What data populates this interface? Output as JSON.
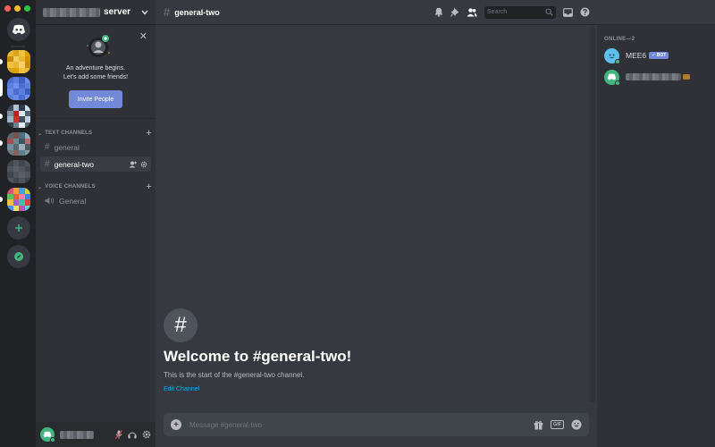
{
  "window": {
    "traffic_colors": [
      "#ff5f57",
      "#febc2e",
      "#28c840"
    ]
  },
  "servers": {
    "icons": [
      {
        "name": "server-1",
        "colors": [
          "#e8b830",
          "#d9a520",
          "#f0c040",
          "#e0a000",
          "#c98a10",
          "#f2d060",
          "#e8b830",
          "#d59000",
          "#f0c040",
          "#e8b830",
          "#fad070",
          "#c98a10",
          "#d9a520",
          "#e0a000",
          "#f0c040",
          "#e8b830"
        ]
      },
      {
        "name": "server-2",
        "colors": [
          "#4a6fd0",
          "#5b7fe0",
          "#3d5fc0",
          "#6a8ae8",
          "#5b7fe0",
          "#7090f0",
          "#4a6fd0",
          "#5b7fe0",
          "#6a8ae8",
          "#4a6fd0",
          "#5b7fe0",
          "#3d5fc0",
          "#5b7fe0",
          "#6a8ae8",
          "#4a6fd0",
          "#7090f0"
        ]
      },
      {
        "name": "server-3",
        "colors": [
          "#3a4a5a",
          "#b0c0d0",
          "#2a3a4a",
          "#d0dde8",
          "#8090a0",
          "#c02020",
          "#e0e8f0",
          "#506070",
          "#a0b0c0",
          "#d03030",
          "#405060",
          "#c0d0e0",
          "#304050",
          "#708090",
          "#e0e8f0",
          "#506070"
        ]
      },
      {
        "name": "server-4",
        "colors": [
          "#5a6a70",
          "#7a5050",
          "#4a7080",
          "#8ab0c0",
          "#a05050",
          "#6a8a90",
          "#3a5a60",
          "#b07070",
          "#7090a0",
          "#5a6a70",
          "#9ab0b8",
          "#4a5a60",
          "#6a7a80",
          "#8a6060",
          "#5a8090",
          "#7a9aa0"
        ]
      },
      {
        "name": "server-5",
        "colors": [
          "#40444b",
          "#4f545c",
          "#40444b",
          "#4f545c",
          "#4f545c",
          "#5a5e66",
          "#4f545c",
          "#40444b",
          "#40444b",
          "#4f545c",
          "#5a5e66",
          "#4f545c",
          "#4f545c",
          "#40444b",
          "#4f545c",
          "#40444b"
        ]
      },
      {
        "name": "server-6",
        "colors": [
          "#e05080",
          "#f0a030",
          "#40a0e0",
          "#d0d040",
          "#60c060",
          "#e06040",
          "#f080b0",
          "#4080e0",
          "#f0c040",
          "#a060d0",
          "#40c0a0",
          "#e04040",
          "#5090f0",
          "#f0e060",
          "#c050c0",
          "#60d0e0"
        ]
      }
    ]
  },
  "sidebar": {
    "server_name": "server",
    "welcome": {
      "line1": "An adventure begins.",
      "line2": "Let's add some friends!",
      "invite_button": "Invite People"
    },
    "text_category": "TEXT CHANNELS",
    "voice_category": "VOICE CHANNELS",
    "text_channels": [
      {
        "label": "general",
        "active": false
      },
      {
        "label": "general-two",
        "active": true
      }
    ],
    "voice_channels": [
      {
        "label": "General"
      }
    ]
  },
  "chat": {
    "channel_name": "general-two",
    "search_placeholder": "Search",
    "welcome_title": "Welcome to #general-two!",
    "welcome_desc": "This is the start of the #general-two channel.",
    "edit_channel": "Edit Channel",
    "message_placeholder": "Message #general-two",
    "gif_label": "GIF"
  },
  "members": {
    "header": "ONLINE—2",
    "list": [
      {
        "name": "MEE6",
        "badge": "✓ BOT",
        "avatar_color": "#5bc0eb"
      },
      {
        "name": "",
        "avatar_color": "#43b581"
      }
    ]
  },
  "colors": {
    "accent": "#7289da",
    "online": "#43b581",
    "link": "#00b0f4"
  }
}
